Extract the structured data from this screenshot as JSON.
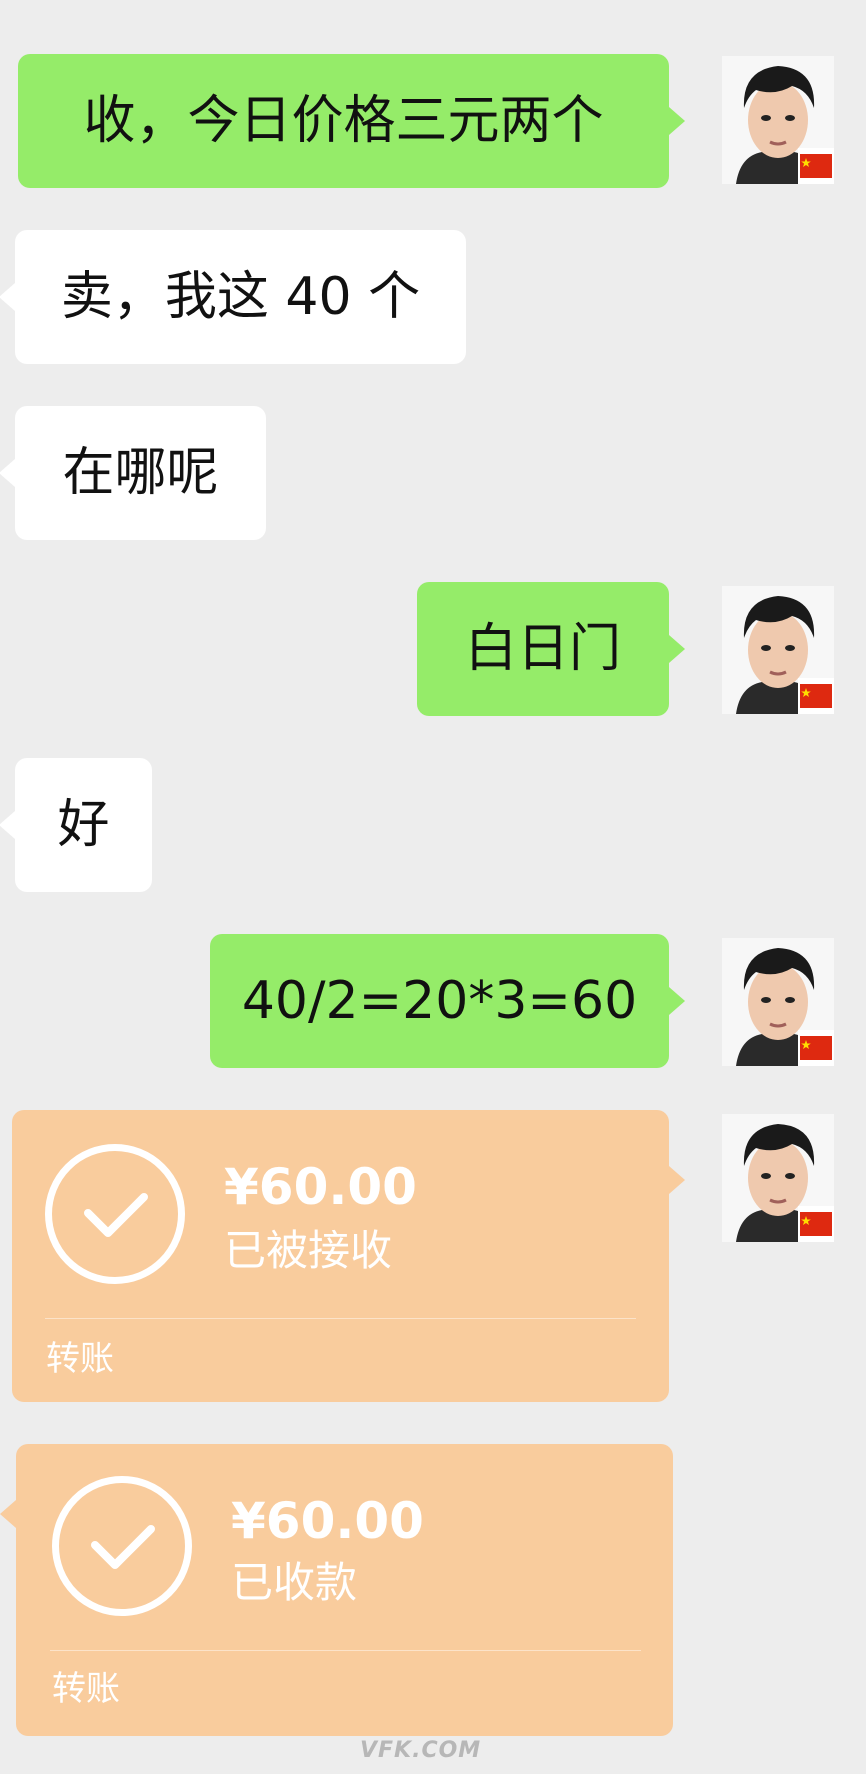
{
  "messages": [
    {
      "text": "收，今日价格三元两个"
    },
    {
      "text": "卖，我这 40 个"
    },
    {
      "text": "在哪呢"
    },
    {
      "text": "白日门"
    },
    {
      "text": "好"
    },
    {
      "text": "40/2=20*3=60"
    }
  ],
  "transfers": [
    {
      "amount": "¥60.00",
      "status": "已被接收",
      "label": "转账"
    },
    {
      "amount": "¥60.00",
      "status": "已收款",
      "label": "转账"
    }
  ],
  "avatar_badge": "china-flag-icon",
  "watermark": "VFK.COM",
  "colors": {
    "background": "#ededed",
    "my_bubble": "#95ec69",
    "their_bubble": "#ffffff",
    "transfer_card": "#f9cc9d"
  }
}
